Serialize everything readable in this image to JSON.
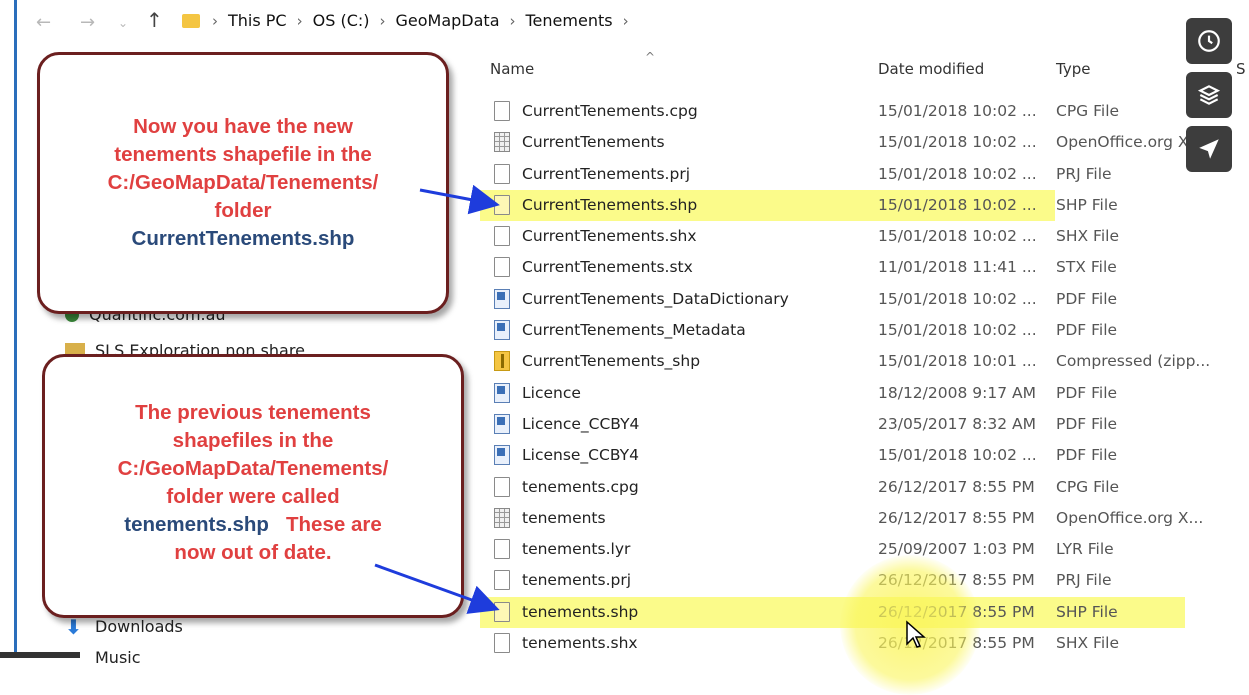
{
  "breadcrumb": [
    "This PC",
    "OS (C:)",
    "GeoMapData",
    "Tenements"
  ],
  "columns": {
    "name": "Name",
    "date": "Date modified",
    "type": "Type",
    "size_partial": "S"
  },
  "nav_items": [
    {
      "label": "Quantific.com.au"
    },
    {
      "label": "SLS Exploration non share"
    },
    {
      "label": "Downloads"
    },
    {
      "label": "Music"
    }
  ],
  "files": [
    {
      "name": "CurrentTenements.cpg",
      "date": "15/01/2018 10:02 ...",
      "type": "CPG File",
      "icon": "document-icon"
    },
    {
      "name": "CurrentTenements",
      "date": "15/01/2018 10:02 ...",
      "type": "OpenOffice.org X...",
      "icon": "spreadsheet-icon"
    },
    {
      "name": "CurrentTenements.prj",
      "date": "15/01/2018 10:02 ...",
      "type": "PRJ File",
      "icon": "document-icon"
    },
    {
      "name": "CurrentTenements.shp",
      "date": "15/01/2018 10:02 ...",
      "type": "SHP File",
      "icon": "document-icon"
    },
    {
      "name": "CurrentTenements.shx",
      "date": "15/01/2018 10:02 ...",
      "type": "SHX File",
      "icon": "document-icon"
    },
    {
      "name": "CurrentTenements.stx",
      "date": "11/01/2018 11:41 ...",
      "type": "STX File",
      "icon": "document-icon"
    },
    {
      "name": "CurrentTenements_DataDictionary",
      "date": "15/01/2018 10:02 ...",
      "type": "PDF File",
      "icon": "pdf-icon"
    },
    {
      "name": "CurrentTenements_Metadata",
      "date": "15/01/2018 10:02 ...",
      "type": "PDF File",
      "icon": "pdf-icon"
    },
    {
      "name": "CurrentTenements_shp",
      "date": "15/01/2018 10:01 ...",
      "type": "Compressed (zipp...",
      "icon": "zip-folder-icon"
    },
    {
      "name": "Licence",
      "date": "18/12/2008 9:17 AM",
      "type": "PDF File",
      "icon": "pdf-icon"
    },
    {
      "name": "Licence_CCBY4",
      "date": "23/05/2017 8:32 AM",
      "type": "PDF File",
      "icon": "pdf-icon"
    },
    {
      "name": "License_CCBY4",
      "date": "15/01/2018 10:02 ...",
      "type": "PDF File",
      "icon": "pdf-icon"
    },
    {
      "name": "tenements.cpg",
      "date": "26/12/2017 8:55 PM",
      "type": "CPG File",
      "icon": "document-icon"
    },
    {
      "name": "tenements",
      "date": "26/12/2017 8:55 PM",
      "type": "OpenOffice.org X...",
      "icon": "spreadsheet-icon"
    },
    {
      "name": "tenements.lyr",
      "date": "25/09/2007 1:03 PM",
      "type": "LYR File",
      "icon": "document-icon"
    },
    {
      "name": "tenements.prj",
      "date": "26/12/2017 8:55 PM",
      "type": "PRJ File",
      "icon": "document-icon"
    },
    {
      "name": "tenements.shp",
      "date": "26/12/2017 8:55 PM",
      "type": "SHP File",
      "icon": "document-icon"
    },
    {
      "name": "tenements.shx",
      "date": "26/12/2017 8:55 PM",
      "type": "SHX File",
      "icon": "document-icon"
    }
  ],
  "highlighted_files": [
    "CurrentTenements.shp",
    "tenements.shp"
  ],
  "callouts": {
    "new": {
      "line1": "Now you have the new",
      "line2": "tenements shapefile in  the",
      "line3": "C:/GeoMapData/Tenements/",
      "line4": "folder",
      "line5": "CurrentTenements.shp"
    },
    "old": {
      "line1": "The previous tenements",
      "line2": "shapefiles in  the",
      "line3": "C:/GeoMapData/Tenements/",
      "line4": "folder were called",
      "line5a": "tenements.shp",
      "line5b": "   These are",
      "line6": "now out of date."
    }
  },
  "side_tools": [
    "clock-icon",
    "layers-icon",
    "send-icon"
  ],
  "colors": {
    "highlight": "#fbfb8a",
    "callout_red": "#e04040",
    "callout_blue": "#2a4a7a",
    "arrow": "#1e3cdc"
  }
}
